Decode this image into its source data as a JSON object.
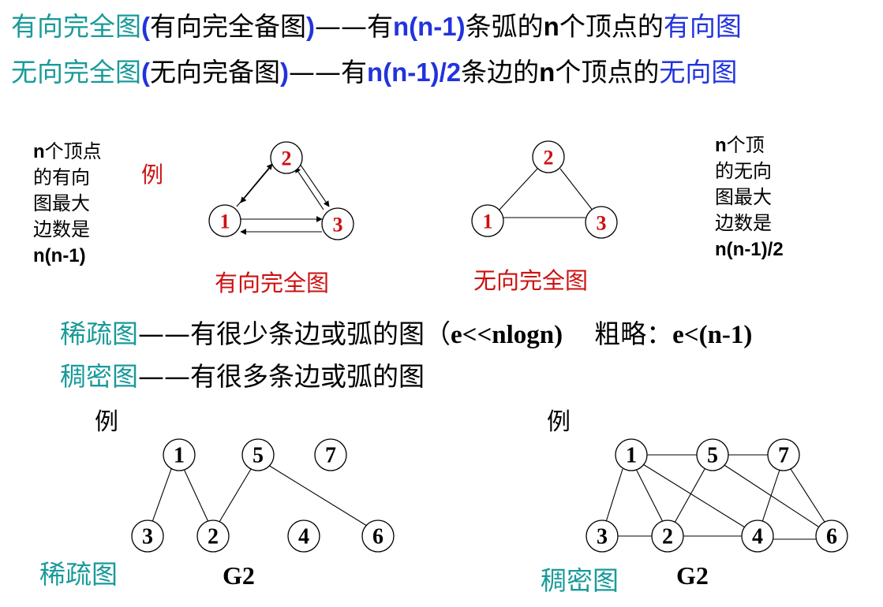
{
  "header": {
    "line1": {
      "term": "有向完全图",
      "p_open": "(",
      "alias": "有向完全备图",
      "p_close": ")",
      "dash": "——",
      "you": "有",
      "formula": "n(n-1)",
      "mid": "条弧的",
      "n": "n",
      "mid2": "个顶点的",
      "tail": "有向图"
    },
    "line2": {
      "term": "无向完全图",
      "p_open": "(",
      "alias": "无向完备图",
      "p_close": ")",
      "dash": "——",
      "you": "有",
      "formula": "n(n-1)/2",
      "mid": "条边的",
      "n": "n",
      "mid2": "个顶点的",
      "tail": "无向图"
    }
  },
  "complete_section": {
    "left_note": {
      "n": "n",
      "l1": "个顶点",
      "l2": "的有向",
      "l3": "图最大",
      "l4": "边数是",
      "l5": "n(n-1)"
    },
    "example_label": "例",
    "directed_caption": "有向完全图",
    "undirected_caption": "无向完全图",
    "right_note": {
      "n": "n",
      "l1": "个顶",
      "l2": "的无向",
      "l3": "图最大",
      "l4": "边数是",
      "l5": "n(n-1)/2"
    },
    "directed_nodes": [
      "2",
      "1",
      "3"
    ],
    "undirected_nodes": [
      "2",
      "1",
      "3"
    ]
  },
  "sparse_dense": {
    "sparse_term": "稀疏图",
    "sparse_dash": "——",
    "sparse_desc": "有很少条边或弧的图（",
    "sparse_cond": "e<<nlogn)",
    "sparse_approx_label": "粗略：",
    "sparse_approx": "e<(n-1)",
    "dense_term": "稠密图",
    "dense_dash": "——",
    "dense_desc": "有很多条边或弧的图"
  },
  "examples": {
    "left_label": "例",
    "right_label": "例",
    "left_caption": "稀疏图",
    "right_caption": "稠密图",
    "left_name": "G2",
    "right_name": "G2",
    "sparse_nodes": [
      "1",
      "5",
      "7",
      "3",
      "2",
      "4",
      "6"
    ],
    "dense_nodes": [
      "1",
      "5",
      "7",
      "3",
      "2",
      "4",
      "6"
    ]
  }
}
